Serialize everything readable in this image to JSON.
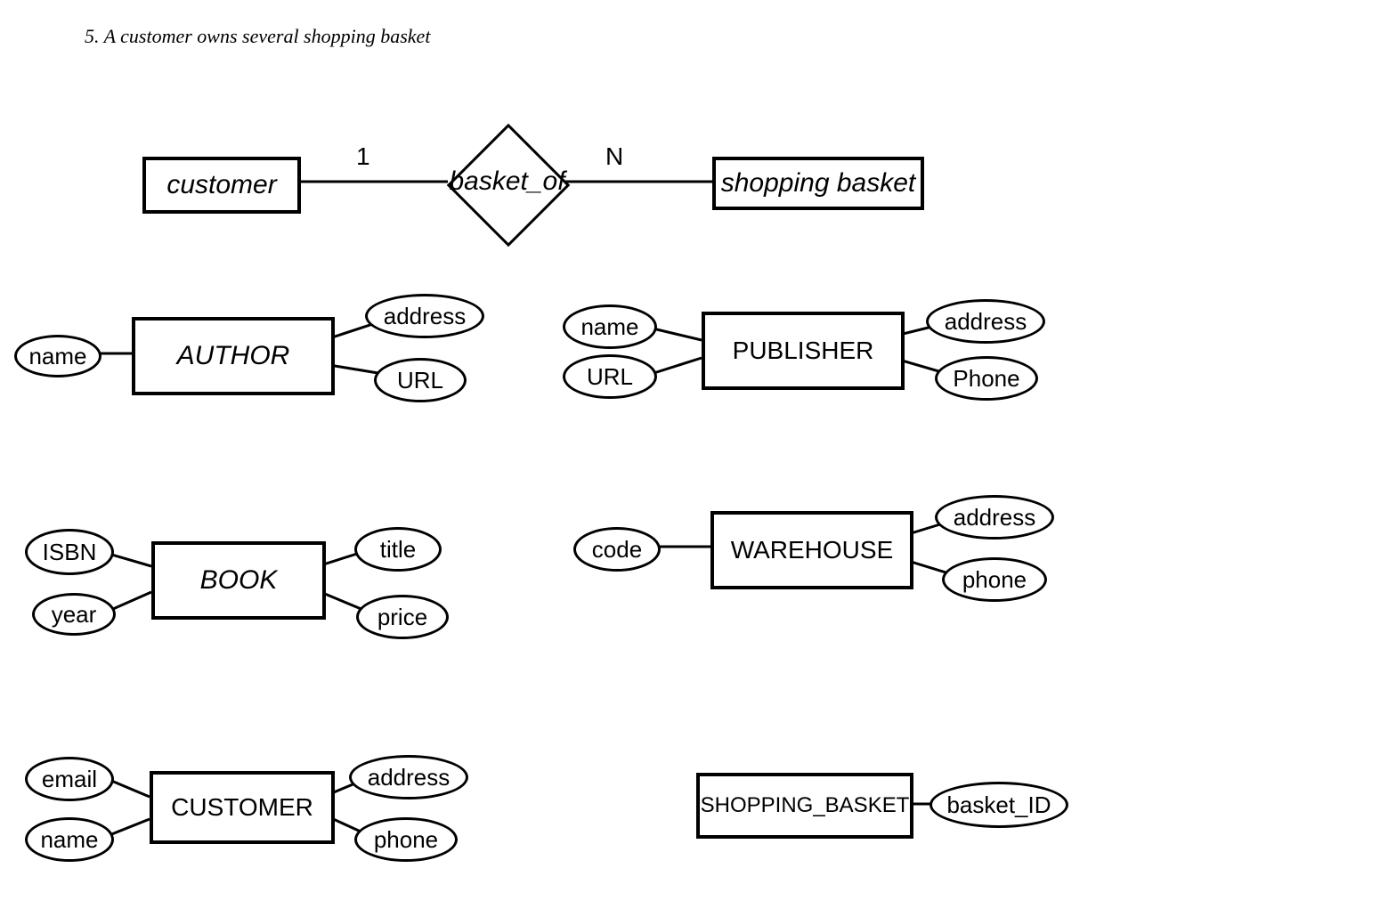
{
  "caption": "5. A customer owns several shopping basket",
  "relationship_diagram": {
    "left_entity": "customer",
    "left_cardinality": "1",
    "relation": "basket_of",
    "right_cardinality": "N",
    "right_entity": "shopping basket"
  },
  "entities": {
    "author": {
      "label": "AUTHOR",
      "attrs": {
        "name": "name",
        "address": "address",
        "url": "URL"
      }
    },
    "publisher": {
      "label": "PUBLISHER",
      "attrs": {
        "name": "name",
        "url": "URL",
        "address": "address",
        "phone": "Phone"
      }
    },
    "book": {
      "label": "BOOK",
      "attrs": {
        "isbn": "ISBN",
        "year": "year",
        "title": "title",
        "price": "price"
      }
    },
    "warehouse": {
      "label": "WAREHOUSE",
      "attrs": {
        "code": "code",
        "address": "address",
        "phone": "phone"
      }
    },
    "customer": {
      "label": "CUSTOMER",
      "attrs": {
        "email": "email",
        "name": "name",
        "address": "address",
        "phone": "phone"
      }
    },
    "shopping_basket": {
      "label": "SHOPPING_BASKET",
      "attrs": {
        "basket_id": "basket_ID"
      }
    }
  }
}
